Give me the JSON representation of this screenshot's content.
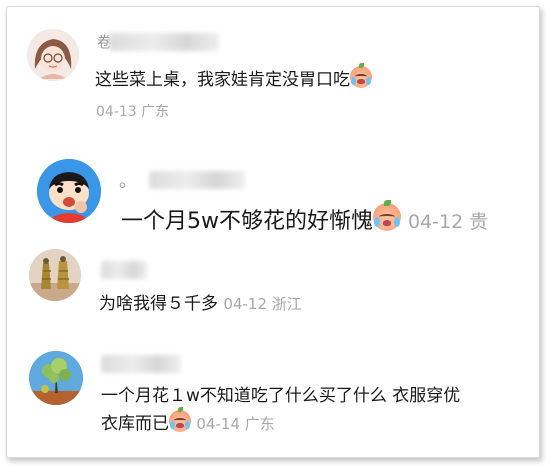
{
  "comments": [
    {
      "name_visible_char": "卷",
      "text": "这些菜上桌，我家娃肯定没胃口吃",
      "date": "04-13",
      "location": "广东",
      "avatar_icon": "girl-with-glasses-avatar",
      "emoji_icon": "crying-face-emoji"
    },
    {
      "name_visible_char": "。",
      "text": "一个月5w不够花的好惭愧",
      "date": "04-12",
      "location": "贵",
      "avatar_icon": "crayon-shinchan-avatar",
      "emoji_icon": "crying-face-emoji"
    },
    {
      "text": "为啥我得５千多",
      "date": "04-12",
      "location": "浙江",
      "avatar_icon": "earrings-photo-avatar"
    },
    {
      "text_line1": "一个月花１w不知道吃了什么买了什么 衣服穿优",
      "text_line2": "衣库而已",
      "date": "04-14",
      "location": "广东",
      "avatar_icon": "tree-landscape-avatar",
      "emoji_icon": "crying-face-emoji"
    }
  ]
}
